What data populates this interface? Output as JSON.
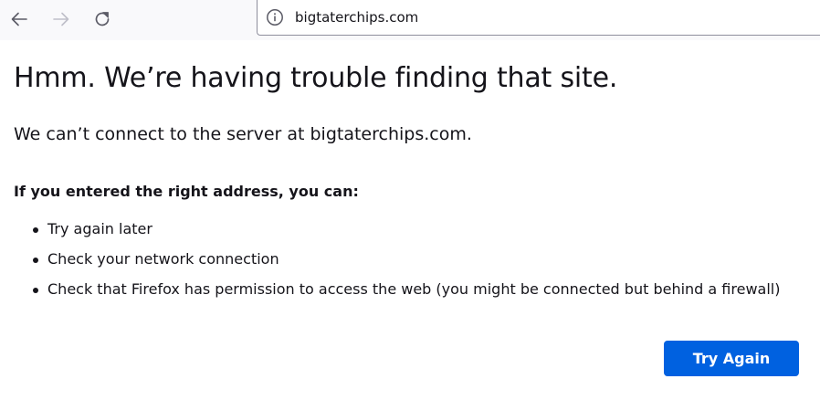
{
  "toolbar": {
    "back_icon": "arrow-left-icon",
    "forward_icon": "arrow-right-icon",
    "reload_icon": "reload-icon",
    "url": "bigtaterchips.com",
    "site_info_icon": "info-icon"
  },
  "error_page": {
    "title": "Hmm. We’re having trouble finding that site.",
    "description": "We can’t connect to the server at bigtaterchips.com.",
    "subheading": "If you entered the right address, you can:",
    "tips": [
      "Try again later",
      "Check your network connection",
      "Check that Firefox has permission to access the web (you might be connected but behind a firewall)"
    ],
    "try_again_label": "Try Again"
  },
  "colors": {
    "accent": "#0061e0",
    "text": "#15141a",
    "toolbar_bg": "#f9f9fb"
  }
}
